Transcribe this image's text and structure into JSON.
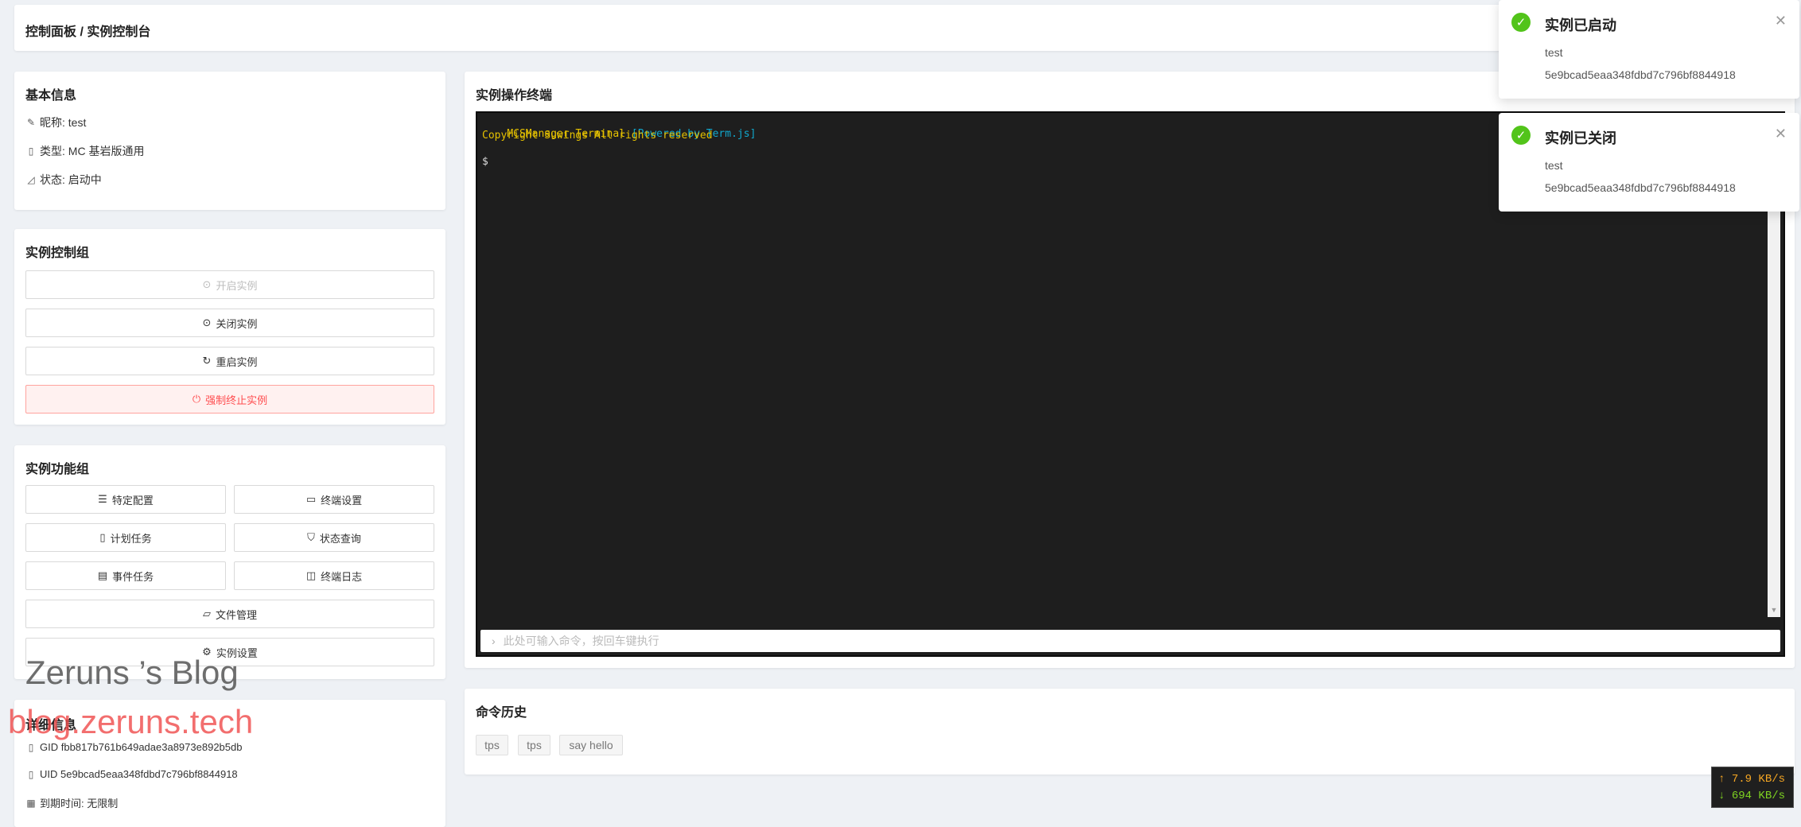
{
  "header": {
    "breadcrumb": "控制面板 / 实例控制台"
  },
  "basic_info": {
    "title": "基本信息",
    "rows": [
      {
        "icon": "edit-icon",
        "text": "昵称: test"
      },
      {
        "icon": "file-icon",
        "text": "类型: MC 基岩版通用"
      },
      {
        "icon": "chart-icon",
        "text": "状态: 启动中"
      }
    ]
  },
  "control_group": {
    "title": "实例控制组",
    "buttons": [
      {
        "icon": "play-circle-icon",
        "label": "开启实例",
        "disabled": true
      },
      {
        "icon": "stop-circle-icon",
        "label": "关闭实例",
        "disabled": false
      },
      {
        "icon": "reload-icon",
        "label": "重启实例",
        "disabled": false
      },
      {
        "icon": "power-icon",
        "label": "强制终止实例",
        "danger": true
      }
    ]
  },
  "function_group": {
    "title": "实例功能组",
    "buttons": [
      {
        "icon": "sliders-icon",
        "label": "特定配置"
      },
      {
        "icon": "desktop-icon",
        "label": "终端设置"
      },
      {
        "icon": "tablet-icon",
        "label": "计划任务"
      },
      {
        "icon": "funnel-icon",
        "label": "状态查询"
      },
      {
        "icon": "reader-icon",
        "label": "事件任务"
      },
      {
        "icon": "book-icon",
        "label": "终端日志"
      },
      {
        "icon": "folder-icon",
        "label": "文件管理"
      },
      {
        "icon": "gear-icon",
        "label": "实例设置"
      }
    ]
  },
  "detail_info": {
    "title": "详细信息",
    "rows": [
      {
        "icon": "file-icon",
        "text": "GID fbb817b761b649adae3a8973e892b5db"
      },
      {
        "icon": "file-icon",
        "text": "UID 5e9bcad5eaa348fdbd7c796bf8844918"
      },
      {
        "icon": "calendar-icon",
        "text": "到期时间: 无限制"
      }
    ]
  },
  "terminal": {
    "title": "实例操作终端",
    "line1_main": "MCSManager Terminal ",
    "line1_powered": "[Powered by Term.js]",
    "line2": "Copyright Suwings All rights reserved",
    "prompt": "$",
    "input_placeholder": "此处可输入命令，按回车键执行",
    "colors": {
      "background": "#1e1e1e",
      "yellow": "#e5c100",
      "cyan": "#11a8cd"
    }
  },
  "history": {
    "title": "命令历史",
    "items": [
      "tps",
      "tps",
      "say hello"
    ]
  },
  "notifications": [
    {
      "title": "实例已启动",
      "name": "test",
      "id": "5e9bcad5eaa348fdbd7c796bf8844918"
    },
    {
      "title": "实例已关闭",
      "name": "test",
      "id": "5e9bcad5eaa348fdbd7c796bf8844918"
    }
  ],
  "watermark": {
    "line1": "Zeruns ’s Blog",
    "line2": "blog.zeruns.tech"
  },
  "net_speed": {
    "up": "7.9 KB/s",
    "down": "694 KB/s"
  }
}
